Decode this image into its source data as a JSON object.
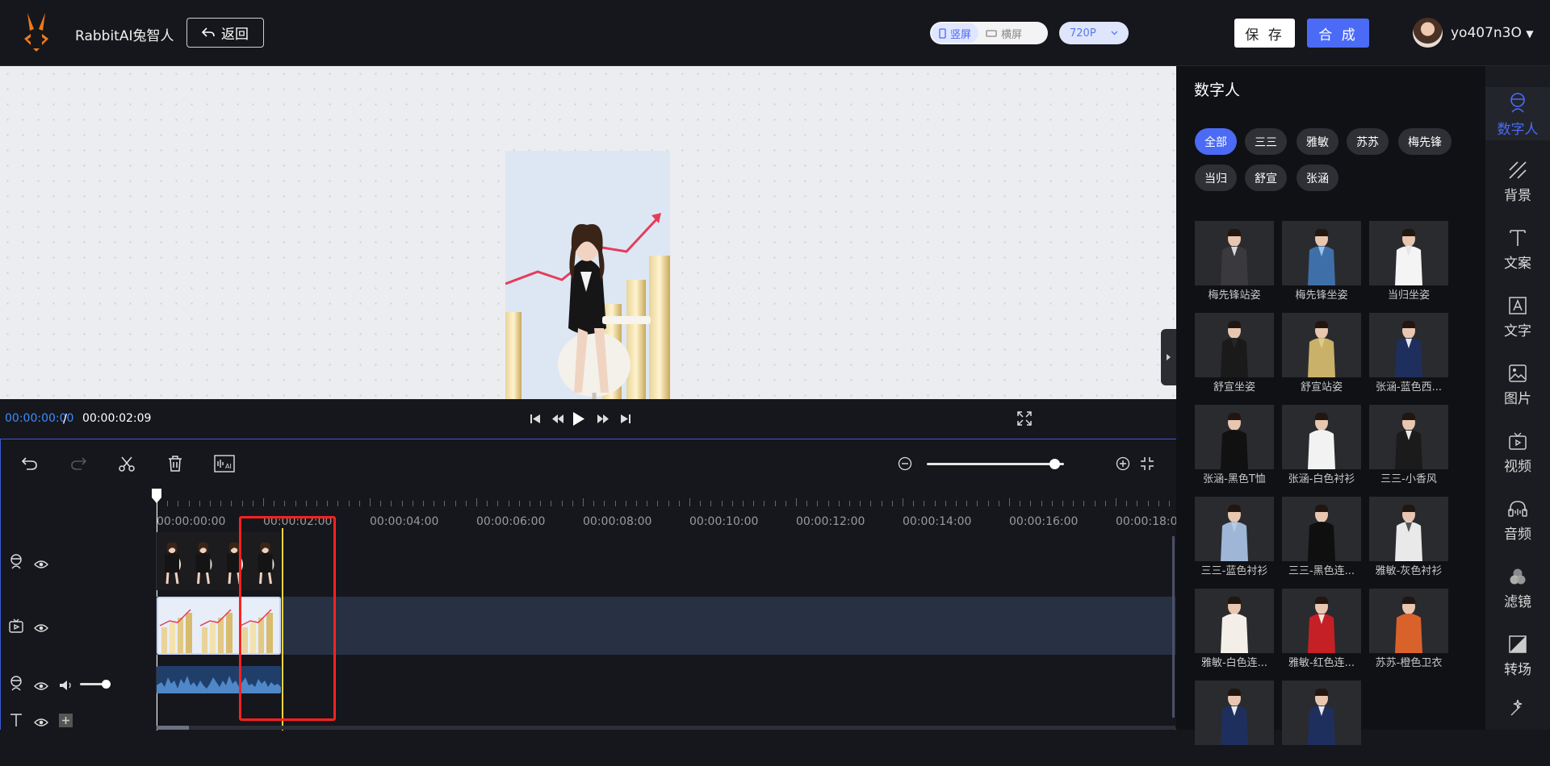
{
  "app": {
    "name": "RabbitAI兔智人",
    "back_label": "返回",
    "orientation": [
      {
        "label": "竖屏",
        "active": true
      },
      {
        "label": "横屏",
        "active": false
      }
    ],
    "resolution": "720P",
    "save_label": "保 存",
    "synthesize_label": "合 成",
    "username": "yo407n3O"
  },
  "player": {
    "current_time": "00:00:00:00",
    "separator": "/",
    "total_time": "00:00:02:09"
  },
  "timeline": {
    "ruler": [
      "00:00:00:00",
      "00:00:02:00",
      "00:00:04:00",
      "00:00:06:00",
      "00:00:08:00",
      "00:00:10:00",
      "00:00:12:00",
      "00:00:14:00",
      "00:00:16:00",
      "00:00:18:00"
    ],
    "zoom_level": 0.93,
    "volume_level": 0.85
  },
  "panel": {
    "title": "数字人",
    "filters": [
      "全部",
      "三三",
      "雅敏",
      "苏苏",
      "梅先锋",
      "当归",
      "舒宣",
      "张涵"
    ],
    "active_filter": "全部",
    "cards": [
      {
        "label": "梅先锋站姿",
        "suit": "#3a3a3e",
        "shirt": "#d8d8dc"
      },
      {
        "label": "梅先锋坐姿",
        "suit": "#3f6fa8",
        "shirt": "#9fc3e6"
      },
      {
        "label": "当归坐姿",
        "suit": "#f4f4f4",
        "shirt": "#e6e6e6"
      },
      {
        "label": "舒宣坐姿",
        "suit": "#1a1a1a",
        "shirt": "#262626"
      },
      {
        "label": "舒宣站姿",
        "suit": "#c9b16a",
        "shirt": "#e0cc8a"
      },
      {
        "label": "张涵-蓝色西...",
        "suit": "#1e2f5e",
        "shirt": "#e8e8e8"
      },
      {
        "label": "张涵-黑色T恤",
        "suit": "#111111",
        "shirt": "#111111"
      },
      {
        "label": "张涵-白色衬衫",
        "suit": "#f2f2f2",
        "shirt": "#f2f2f2"
      },
      {
        "label": "三三-小香风",
        "suit": "#1b1b1b",
        "shirt": "#e8e8e8"
      },
      {
        "label": "三三-蓝色衬衫",
        "suit": "#9fb6d6",
        "shirt": "#b8cbe4"
      },
      {
        "label": "三三-黑色连...",
        "suit": "#0f0f0f",
        "shirt": "#0f0f0f"
      },
      {
        "label": "雅敏-灰色衬衫",
        "suit": "#e9e9e9",
        "shirt": "#555555"
      },
      {
        "label": "雅敏-白色连...",
        "suit": "#f3efe8",
        "shirt": "#f3efe8"
      },
      {
        "label": "雅敏-红色连...",
        "suit": "#c42026",
        "shirt": "#efe6dc"
      },
      {
        "label": "苏苏-橙色卫衣",
        "suit": "#d9622b",
        "shirt": "#d9622b"
      },
      {
        "label": "",
        "suit": "#1e2f5e",
        "shirt": "#e8e8e8"
      },
      {
        "label": "",
        "suit": "#1e2f5e",
        "shirt": "#e8e8e8"
      }
    ]
  },
  "rail": [
    {
      "label": "数字人",
      "icon": "digital-human-icon",
      "active": true
    },
    {
      "label": "背景",
      "icon": "background-icon",
      "active": false
    },
    {
      "label": "文案",
      "icon": "script-icon",
      "active": false
    },
    {
      "label": "文字",
      "icon": "text-icon",
      "active": false
    },
    {
      "label": "图片",
      "icon": "image-icon",
      "active": false
    },
    {
      "label": "视频",
      "icon": "video-icon",
      "active": false
    },
    {
      "label": "音频",
      "icon": "audio-icon",
      "active": false
    },
    {
      "label": "滤镜",
      "icon": "filter-icon",
      "active": false
    },
    {
      "label": "转场",
      "icon": "transition-icon",
      "active": false
    },
    {
      "label": "",
      "icon": "magic-icon",
      "active": false
    }
  ],
  "colors": {
    "accent": "#4b6bf6",
    "highlight": "#ff2020",
    "playhead": "#f5d442",
    "time": "#3d8bff"
  }
}
